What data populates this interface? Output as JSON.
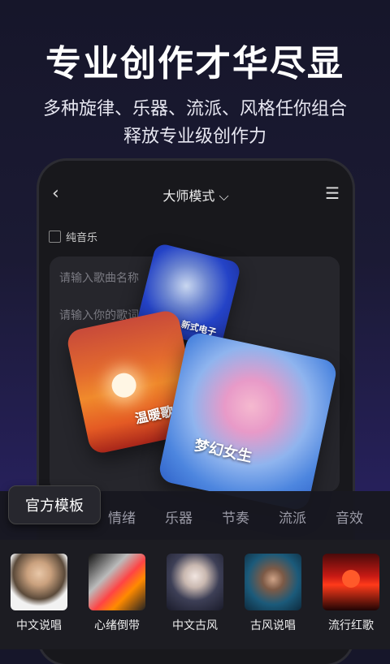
{
  "promo": {
    "headline": "专业创作才华尽显",
    "subline1": "多种旋律、乐器、流派、风格任你组合",
    "subline2": "释放专业级创作力"
  },
  "app": {
    "nav": {
      "back_icon": "‹",
      "title": "大师模式 ⌵",
      "menu_icon": "☰"
    },
    "pure_music_label": "纯音乐",
    "inputs": {
      "song_name_placeholder": "请输入歌曲名称",
      "lyrics_placeholder": "请输入你的歌词或"
    },
    "style_cards": [
      {
        "label": "新式电子"
      },
      {
        "label": "温暖歌颂"
      },
      {
        "label": "梦幻女生"
      }
    ],
    "tabs": {
      "active": "官方模板",
      "items": [
        "情绪",
        "乐器",
        "节奏",
        "流派",
        "音效"
      ]
    },
    "templates": [
      {
        "label": "中文说唱"
      },
      {
        "label": "心绪倒带"
      },
      {
        "label": "中文古风"
      },
      {
        "label": "古风说唱"
      },
      {
        "label": "流行红歌"
      }
    ]
  }
}
